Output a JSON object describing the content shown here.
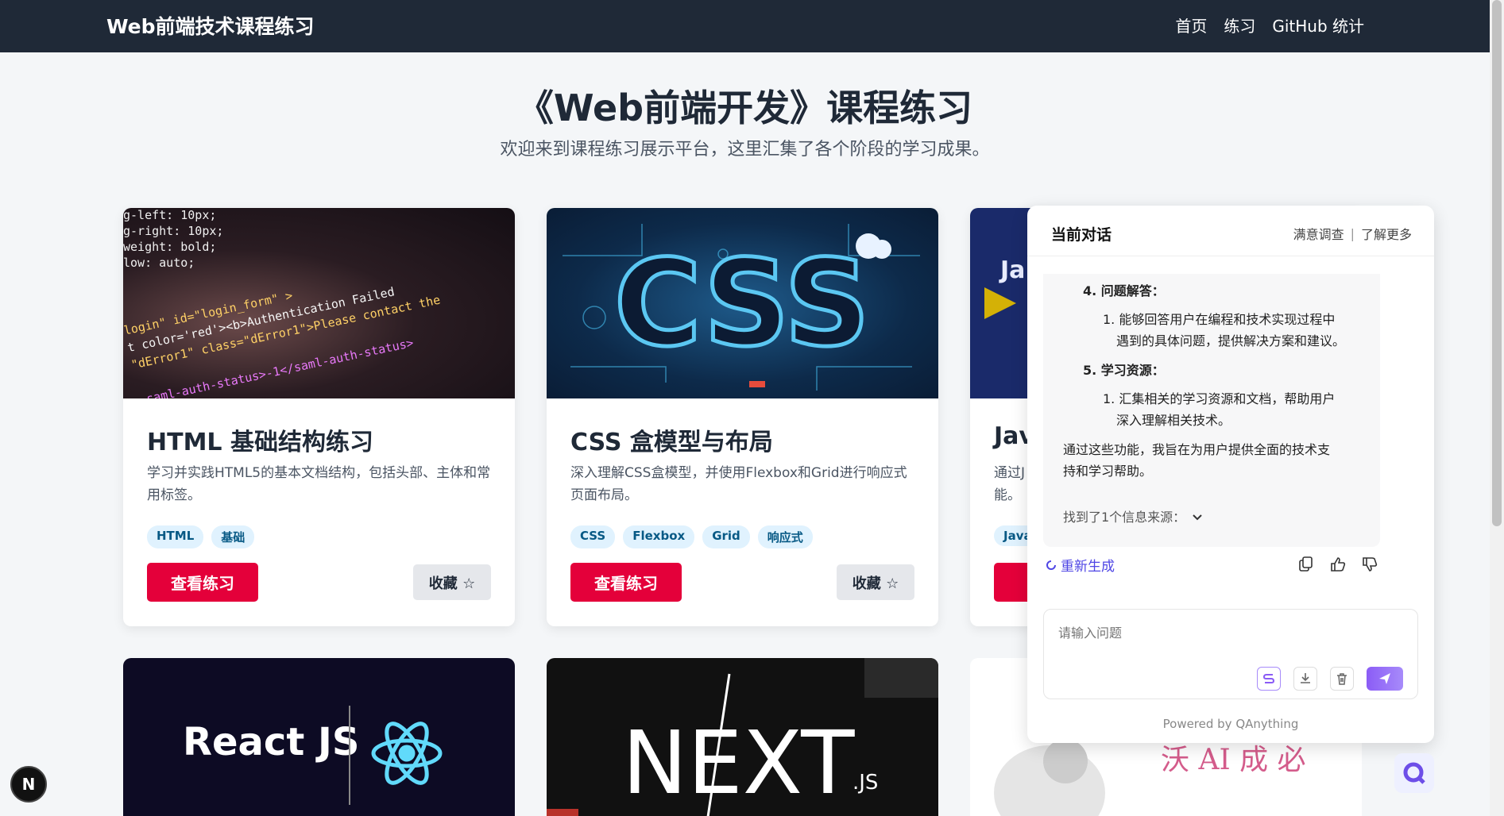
{
  "header": {
    "brand": "Web前端技术课程练习",
    "nav": [
      "首页",
      "练习",
      "GitHub 统计"
    ]
  },
  "hero": {
    "title": "《Web前端开发》课程练习",
    "subtitle": "欢迎来到课程练习展示平台，这里汇集了各个阶段的学习成果。"
  },
  "cards": [
    {
      "title": "HTML 基础结构练习",
      "desc": "学习并实践HTML5的基本文档结构，包括头部、主体和常用标签。",
      "tags": [
        "HTML",
        "基础"
      ],
      "view_label": "查看练习",
      "fav_label": "收藏 ☆",
      "image_text": [
        "g-left: 10px;",
        "g-right: 10px;",
        "weight: bold;",
        "low: auto;",
        "login\" id=\"login_form\" >",
        "t color='red'><b>Authentication Failed",
        "\"dError1\" class=\"dError1\">Please contact the",
        "saml-auth-status>-1</saml-auth-status>"
      ]
    },
    {
      "title": "CSS 盒模型与布局",
      "desc": "深入理解CSS盒模型，并使用Flexbox和Grid进行响应式页面布局。",
      "tags": [
        "CSS",
        "Flexbox",
        "Grid",
        "响应式"
      ],
      "view_label": "查看练习",
      "fav_label": "收藏 ☆",
      "image_text": "CSS"
    },
    {
      "title": "Jav",
      "desc_lines": [
        "通过J",
        "能。"
      ],
      "tags": [
        "Java"
      ],
      "view_label": "查",
      "image_text": "Ja"
    }
  ],
  "bottom_cards": [
    {
      "image_text": "React JS"
    },
    {
      "image_text": "NEXT",
      "image_sub": ".JS"
    },
    {
      "image_text": "沃 AI 成 必"
    }
  ],
  "chat": {
    "title": "当前对话",
    "links": [
      "满意调查",
      "了解更多"
    ],
    "items": [
      {
        "num": "4.",
        "heading": "问题解答：",
        "sub_num": "1.",
        "sub": [
          "能够回答用户在编程和技术实现过程中",
          "遇到的具体问题，提供解决方案和建议。"
        ]
      },
      {
        "num": "5.",
        "heading": "学习资源：",
        "sub_num": "1.",
        "sub": [
          "汇集相关的学习资源和文档，帮助用户",
          "深入理解相关技术。"
        ]
      }
    ],
    "summary": [
      "通过这些功能，我旨在为用户提供全面的技术支",
      "持和学习帮助。"
    ],
    "sources": "找到了1个信息来源：",
    "regenerate": "重新生成",
    "input_placeholder": "请输入问题",
    "powered": "Powered by QAnything"
  },
  "fab_n": "N",
  "colors": {
    "header_bg": "#1f2937",
    "primary_btn": "#e4003a",
    "tag_bg": "#e0f2fe",
    "accent": "#4f46e5"
  }
}
